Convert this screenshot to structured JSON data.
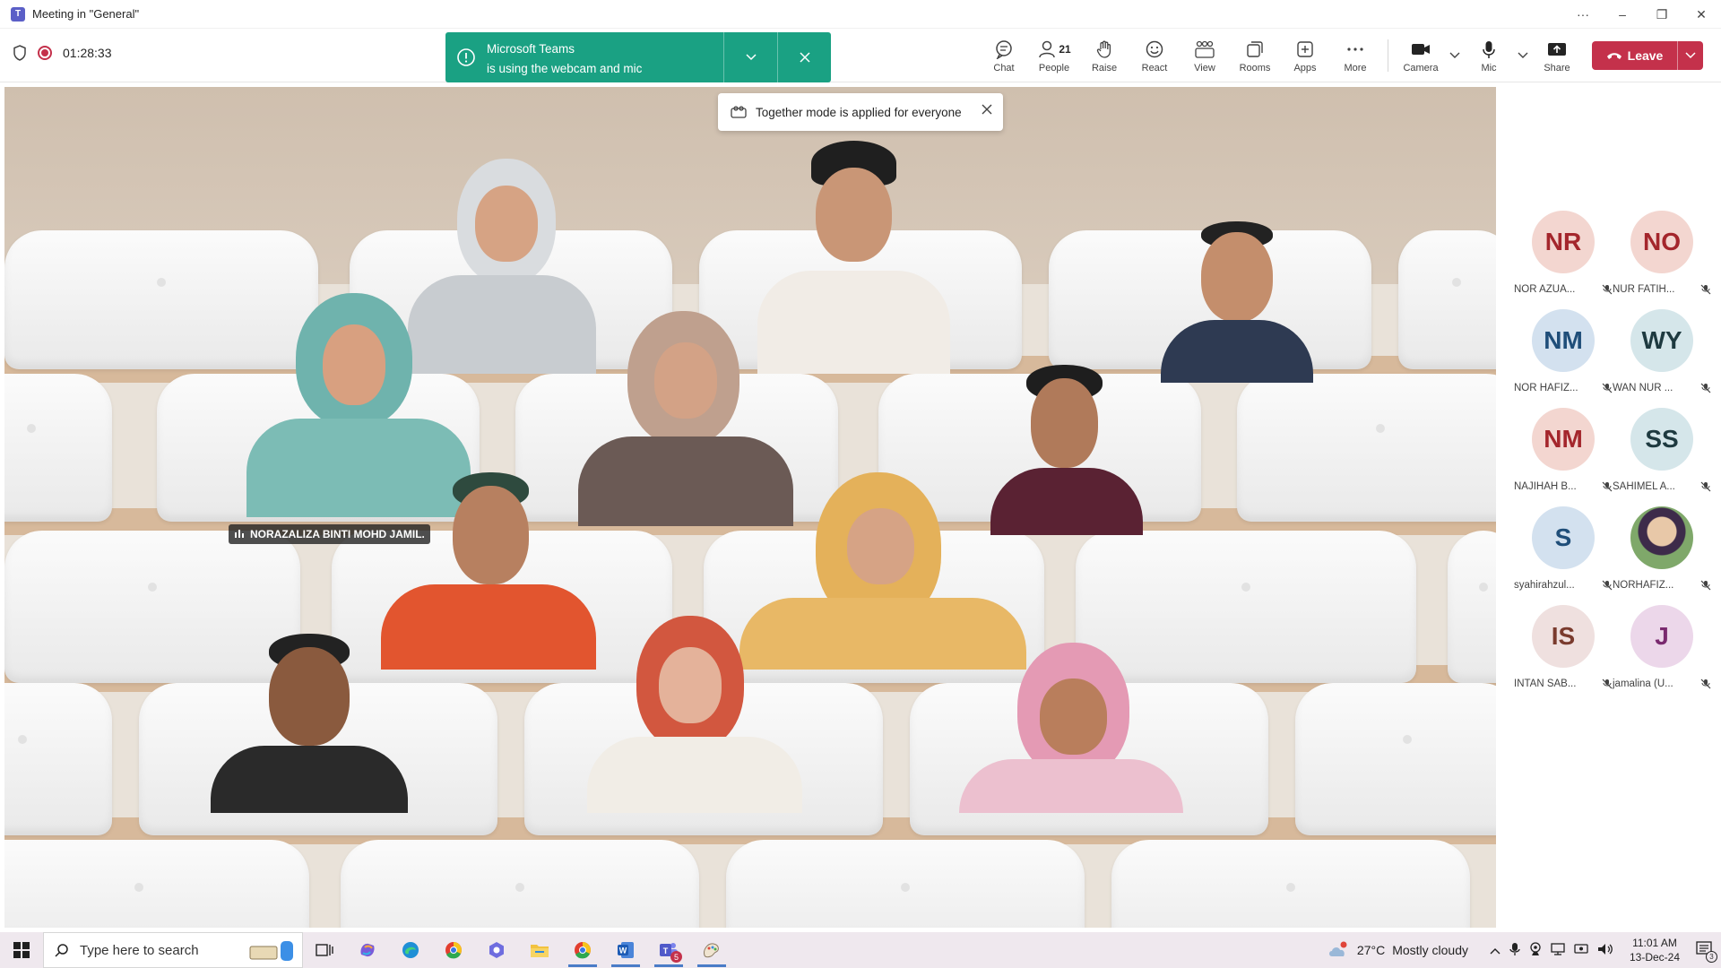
{
  "titlebar": {
    "title": "Meeting in \"General\"",
    "more": "···",
    "minimize": "–",
    "restore": "❐",
    "close": "✕"
  },
  "meeting": {
    "timer": "01:28:33",
    "toolbar": {
      "chat": "Chat",
      "people": "People",
      "people_count": "21",
      "raise": "Raise",
      "react": "React",
      "view": "View",
      "rooms": "Rooms",
      "apps": "Apps",
      "more": "More",
      "camera": "Camera",
      "mic": "Mic",
      "share": "Share",
      "leave": "Leave"
    }
  },
  "notification": {
    "line1": "Microsoft Teams",
    "line2": "is using the webcam and mic"
  },
  "together_banner": {
    "text": "Together mode is applied for everyone"
  },
  "speaker_nametag": {
    "name": "NORAZALIZA BINTI MOHD JAMIL."
  },
  "roster": [
    {
      "initials": "NR",
      "name": "NOR AZUA...",
      "bg": "#f3d6d0",
      "fg": "#a4262c"
    },
    {
      "initials": "NO",
      "name": "NUR FATIH...",
      "bg": "#f3d6d0",
      "fg": "#a4262c"
    },
    {
      "initials": "NM",
      "name": "NOR HAFIZ...",
      "bg": "#d3e1ef",
      "fg": "#1f4e79"
    },
    {
      "initials": "WY",
      "name": "WAN NUR ...",
      "bg": "#d5e6ea",
      "fg": "#1e3a40"
    },
    {
      "initials": "NM",
      "name": "NAJIHAH B...",
      "bg": "#f3d6d0",
      "fg": "#a4262c"
    },
    {
      "initials": "SS",
      "name": "SAHIMEL A...",
      "bg": "#d5e6ea",
      "fg": "#1e3a40"
    },
    {
      "initials": "S",
      "name": "syahirahzul...",
      "bg": "#d3e1ef",
      "fg": "#1f4e79"
    },
    {
      "initials": "",
      "name": "NORHAFIZ...",
      "bg": "#6b4b3a",
      "fg": "#ffffff"
    },
    {
      "initials": "IS",
      "name": "INTAN SAB...",
      "bg": "#efe0df",
      "fg": "#7a3b2e"
    },
    {
      "initials": "J",
      "name": "jamalina (U...",
      "bg": "#ecd7ea",
      "fg": "#7a2a6f"
    }
  ],
  "taskbar": {
    "search_placeholder": "Type here to search",
    "weather_temp": "27°C",
    "weather_desc": "Mostly cloudy",
    "time": "11:01 AM",
    "date": "13-Dec-24",
    "teams_badge": "5",
    "notif_count": "3"
  }
}
